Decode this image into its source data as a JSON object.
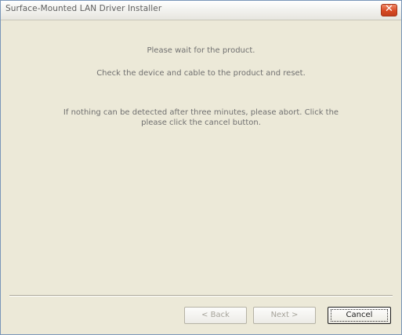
{
  "window": {
    "title": "Surface-Mounted LAN Driver Installer"
  },
  "messages": {
    "line1": "Please wait for the product.",
    "line2": "Check the device and cable to the product and reset.",
    "line3": "If nothing can be detected after three minutes, please abort. Click the",
    "line4": "please click the cancel button."
  },
  "buttons": {
    "back": "< Back",
    "next": "Next >",
    "cancel": "Cancel"
  }
}
